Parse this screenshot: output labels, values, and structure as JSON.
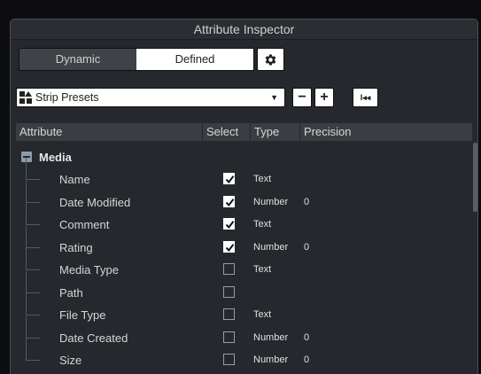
{
  "window": {
    "title": "Attribute Inspector"
  },
  "toolbar": {
    "tabs": [
      {
        "label": "Dynamic",
        "active": false
      },
      {
        "label": "Defined",
        "active": true
      }
    ],
    "settings_icon": "gear-icon"
  },
  "presets": {
    "label": "Strip Presets",
    "icon": "strip-presets-icon",
    "remove_label": "−",
    "add_label": "+",
    "reset_label": "I◂◂"
  },
  "table": {
    "headers": {
      "attribute": "Attribute",
      "select": "Select",
      "type": "Type",
      "precision": "Precision"
    },
    "group": {
      "label": "Media",
      "expanded": true
    },
    "rows": [
      {
        "name": "Name",
        "selected": true,
        "type": "Text",
        "precision": ""
      },
      {
        "name": "Date Modified",
        "selected": true,
        "type": "Number",
        "precision": "0"
      },
      {
        "name": "Comment",
        "selected": true,
        "type": "Text",
        "precision": ""
      },
      {
        "name": "Rating",
        "selected": true,
        "type": "Number",
        "precision": "0"
      },
      {
        "name": "Media Type",
        "selected": false,
        "type": "Text",
        "precision": ""
      },
      {
        "name": "Path",
        "selected": false,
        "type": "",
        "precision": ""
      },
      {
        "name": "File Type",
        "selected": false,
        "type": "Text",
        "precision": ""
      },
      {
        "name": "Date Created",
        "selected": false,
        "type": "Number",
        "precision": "0"
      },
      {
        "name": "Size",
        "selected": false,
        "type": "Number",
        "precision": "0"
      }
    ]
  },
  "colors": {
    "panel": "#25282c",
    "header": "#3a3d41",
    "accent_white": "#ffffff",
    "expander": "#8a9bab"
  }
}
